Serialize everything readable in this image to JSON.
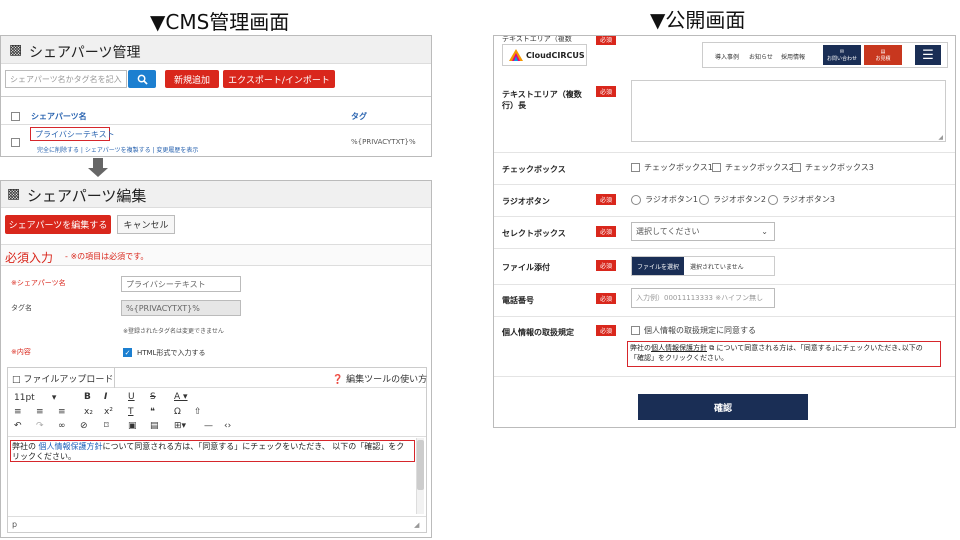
{
  "headings": {
    "cms": "▼CMS管理画面",
    "public": "▼公開画面"
  },
  "share_list": {
    "title": "シェアパーツ管理",
    "search_placeholder": "シェアパーツ名かタグ名を記入",
    "new_button": "新規追加",
    "export_button": "エクスポート/インポート",
    "col_name": "シェアパーツ名",
    "col_tag": "タグ",
    "row_name": "プライバシーテキスト",
    "row_actions": "完全に削除する | シェアパーツを複製する | 変更履歴を表示",
    "row_tag": "%{PRIVACYTXT}%"
  },
  "share_edit": {
    "title": "シェアパーツ編集",
    "edit_button": "シェアパーツを編集する",
    "cancel_button": "キャンセル",
    "required_title": "必須入力",
    "required_note": "※の項目は必須です。",
    "name_label": "※シェアパーツ名",
    "name_value": "プライバシーテキスト",
    "tag_label": "タグ名",
    "tag_value": "%{PRIVACYTXT}%",
    "tag_note": "※登録されたタグ名は変更できません",
    "content_label": "※内容",
    "html_check": "HTML形式で入力する",
    "upload_tab": "ファイルアップロード",
    "help_link": "編集ツールの使い方",
    "font_size": "11pt",
    "editor_prefix": "弊社の",
    "editor_link": "個人情報保護方針",
    "editor_rest": "について同意される方は、「同意する」にチェックをいただき、 以下の「確認」をクリックください。",
    "status_p": "p"
  },
  "public_form": {
    "logo": "CloudCIRCUS",
    "nav": [
      "導入事例",
      "お知らせ",
      "採用情報"
    ],
    "contact_btn": "お問い合わせ",
    "estimate_btn": "お見積",
    "top_label": "テキストエリア（複数",
    "required": "必須",
    "textarea_label": "テキストエリア（複数行）長",
    "checkbox_label": "チェックボックス",
    "checkbox_opts": [
      "チェックボックス1",
      "チェックボックス2",
      "チェックボックス3"
    ],
    "radio_label": "ラジオボタン",
    "radio_opts": [
      "ラジオボタン1",
      "ラジオボタン2",
      "ラジオボタン3"
    ],
    "select_label": "セレクトボックス",
    "select_value": "選択してください",
    "file_label": "ファイル添付",
    "file_button": "ファイルを選択",
    "file_status": "選択されていません",
    "tel_label": "電話番号",
    "tel_placeholder": "入力例）00011113333 ※ハイフン無し",
    "privacy_label": "個人情報の取扱規定",
    "privacy_check": "個人情報の取扱規定に同意する",
    "privacy_prefix": "弊社の",
    "privacy_link": "個人情報保護方針",
    "privacy_rest": " について同意される方は、｢同意する｣にチェックいただき､以下の",
    "privacy_line2": "「確認」をクリックください。",
    "submit": "確認"
  },
  "colors": {
    "accent_red": "#d9271c",
    "accent_blue": "#1c7fd0",
    "navy": "#1a2e55"
  }
}
